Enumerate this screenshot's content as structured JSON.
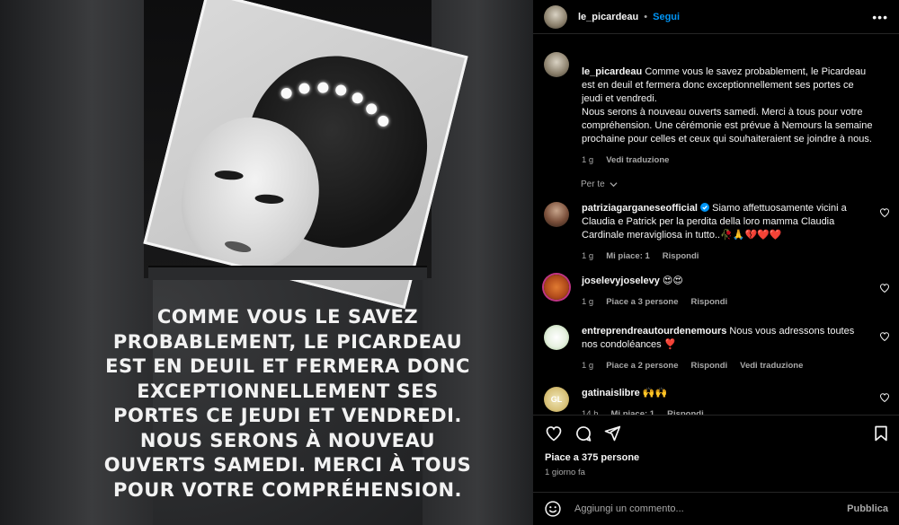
{
  "post": {
    "overlay_text": "COMME VOUS LE SAVEZ\nPROBABLEMENT, LE PICARDEAU\nEST EN DEUIL ET FERMERA DONC\nEXCEPTIONNELLEMENT SES\nPORTES CE JEUDI ET VENDREDI.\nNOUS SERONS À NOUVEAU\nOUVERTS SAMEDI. MERCI À TOUS\nPOUR VOTRE COMPRÉHENSION."
  },
  "header": {
    "username": "le_picardeau",
    "dot": "•",
    "follow_label": "Segui",
    "more_icon": "more-horizontal-icon"
  },
  "caption": {
    "username": "le_picardeau",
    "text": " Comme vous le savez probablement, le Picardeau est en deuil et fermera donc exceptionnellement ses portes ce jeudi et vendredi.\nNous serons à nouveau ouverts samedi. Merci à tous pour votre compréhension. Une cérémonie est prévue à Nemours la semaine prochaine pour celles et ceux qui souhaiteraient se joindre à nous.",
    "time": "1 g",
    "translate": "Vedi traduzione"
  },
  "for_you": "Per te",
  "comments": [
    {
      "username": "patriziagarganeseofficial",
      "verified": true,
      "text": " Siamo affettuosamente vicini a Claudia e Patrick per la perdita della loro mamma Claudia Cardinale meravigliosa in tutto..🥀🙏💔❤️❤️",
      "time": "1 g",
      "likes": "Mi piace: 1",
      "reply": "Rispondi",
      "translate": ""
    },
    {
      "username": "joselevyjoselevy",
      "verified": false,
      "text": " 😍😍",
      "time": "1 g",
      "likes": "Piace a 3 persone",
      "reply": "Rispondi",
      "translate": ""
    },
    {
      "username": "entreprendreautourdenemours",
      "verified": false,
      "text": " Nous vous adressons toutes nos condoléances ❣️",
      "time": "1 g",
      "likes": "Piace a 2 persone",
      "reply": "Rispondi",
      "translate": "Vedi traduzione"
    },
    {
      "username": "gatinaislibre",
      "verified": false,
      "text": " 🙌🙌",
      "time": "14 h",
      "likes": "Mi piace: 1",
      "reply": "Rispondi",
      "translate": ""
    }
  ],
  "likes_count": "Piace a 375 persone",
  "posted_ago": "1 giorno fa",
  "add_comment": {
    "placeholder": "Aggiungi un commento...",
    "publish_label": "Pubblica"
  },
  "gatinais_avatar_text": "GL",
  "colors": {
    "accent": "#0095f6",
    "muted": "#a8a8a8",
    "background": "#000000"
  }
}
